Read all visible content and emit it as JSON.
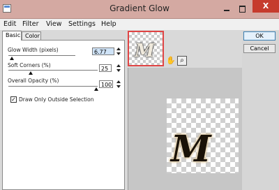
{
  "window": {
    "title": "Gradient Glow",
    "close_glyph": "X"
  },
  "menu": {
    "items": [
      "Edit",
      "Filter",
      "View",
      "Settings",
      "Help"
    ]
  },
  "tabs": [
    "Basic",
    "Color"
  ],
  "basic": {
    "glow_width": {
      "label": "Glow Width (pixels)",
      "value": "6.77"
    },
    "soft_corners": {
      "label": "Soft Corners (%)",
      "value": "25"
    },
    "overall_opacity": {
      "label": "Overall Opacity (%)",
      "value": "100"
    },
    "draw_only_outside": {
      "label": "Draw Only Outside Selection",
      "checked": true
    }
  },
  "preview": {
    "letter": "M"
  },
  "tools": {
    "hand": "hand-icon",
    "zoom": "magnifier-icon"
  },
  "buttons": {
    "ok": "OK",
    "cancel": "Cancel"
  },
  "colors": {
    "titlebar": "#d4a9a2",
    "close": "#c63b2d",
    "thumb_border": "#e04545"
  }
}
